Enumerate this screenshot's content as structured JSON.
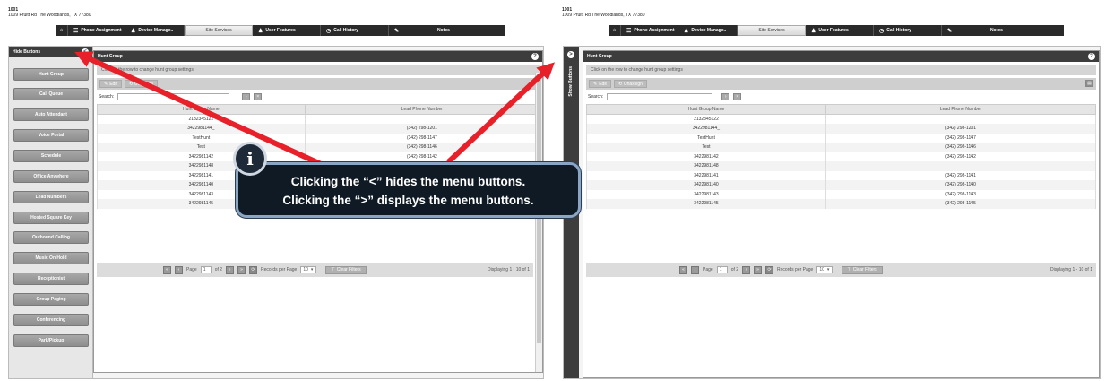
{
  "left": {
    "account_number": "1001",
    "address": "1009 Pruitt Rd The Woodlands, TX 77380",
    "tabs": [
      "Phone Assignment",
      "Device Manage..",
      "Site Services",
      "User Features",
      "Call History",
      "Notes"
    ],
    "sidebar": {
      "header": "Hide Buttons",
      "toggle_icon": "<",
      "items": [
        "Hunt Group",
        "Call Queue",
        "Auto Attendant",
        "Voice Portal",
        "Schedule",
        "Office Anywhere",
        "Lead Numbers",
        "Hosted Square Key",
        "Outbound Calling",
        "Music On Hold",
        "Receptionist",
        "Group Paging",
        "Conferencing",
        "Park/Pickup"
      ]
    },
    "panel": {
      "title": "Hunt Group",
      "hint": "Click on the row to change hunt group settings",
      "edit": "Edit",
      "unassign": "Unassign",
      "search_label": "Search:",
      "col1": "Hunt Group Name",
      "col2": "Lead Phone Number"
    }
  },
  "right": {
    "account_number": "1001",
    "address": "1009 Pruitt Rd The Woodlands, TX 77380",
    "tabs": [
      "Phone Assignment",
      "Device Manage..",
      "Site Services",
      "User Features",
      "Call History",
      "Notes"
    ],
    "collapsed_label": "Show Buttons",
    "toggle_icon": ">",
    "panel": {
      "title": "Hunt Group",
      "hint": "Click on the row to change hunt group settings",
      "edit": "Edit",
      "unassign": "Unassign",
      "search_label": "Search:",
      "col1": "Hunt Group Name",
      "col2": "Lead Phone Number"
    }
  },
  "rows": [
    {
      "name": "2132345122",
      "phone": ""
    },
    {
      "name": "3422981144_",
      "phone": "(342) 298-1201"
    },
    {
      "name": "TestHunt",
      "phone": "(342) 298-1147"
    },
    {
      "name": "Test",
      "phone": "(342) 298-1146"
    },
    {
      "name": "3422981142",
      "phone": "(342) 298-1142"
    },
    {
      "name": "3422981148",
      "phone": ""
    },
    {
      "name": "3422981141",
      "phone": "(342) 298-1141"
    },
    {
      "name": "3422981140",
      "phone": "(342) 298-1140"
    },
    {
      "name": "3422981143",
      "phone": "(342) 298-1143"
    },
    {
      "name": "3422981145",
      "phone": "(342) 298-1145"
    }
  ],
  "pager": {
    "page_label": "Page",
    "page": "1",
    "of": "of 2",
    "records_label": "Records per Page",
    "records": "10",
    "clear": "Clear Filters",
    "displaying": "Displaying 1 - 10 of 1"
  },
  "callout": {
    "badge": "i",
    "line1": "Clicking the “<” hides the menu buttons.",
    "line2": "Clicking the “>” displays the menu buttons."
  },
  "colors": {
    "arrow": "#e8202a",
    "header": "#3d3d3d",
    "callout_bg": "#0f1a24"
  }
}
